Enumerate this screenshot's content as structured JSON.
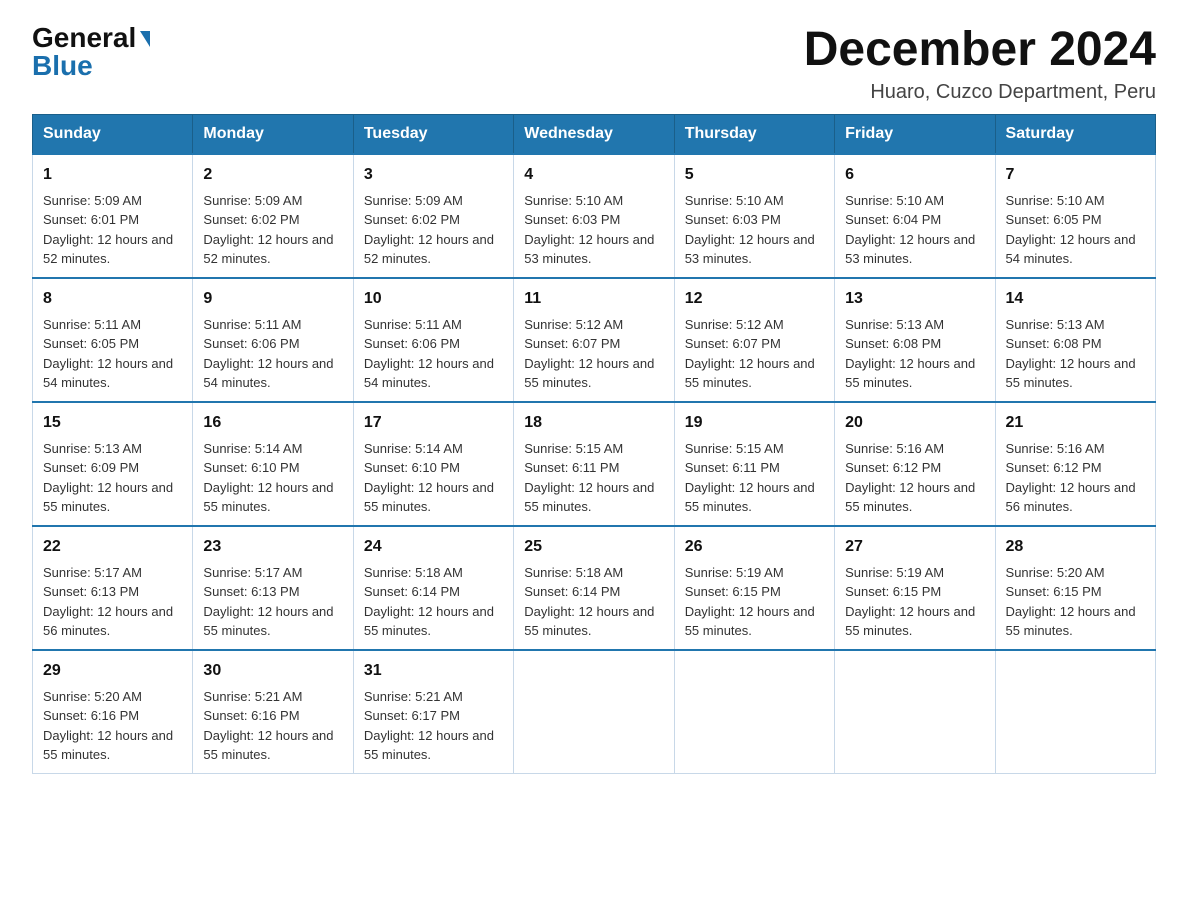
{
  "header": {
    "logo_general": "General",
    "logo_blue": "Blue",
    "title": "December 2024",
    "subtitle": "Huaro, Cuzco Department, Peru"
  },
  "days_of_week": [
    "Sunday",
    "Monday",
    "Tuesday",
    "Wednesday",
    "Thursday",
    "Friday",
    "Saturday"
  ],
  "weeks": [
    [
      {
        "num": "1",
        "sunrise": "5:09 AM",
        "sunset": "6:01 PM",
        "daylight": "12 hours and 52 minutes."
      },
      {
        "num": "2",
        "sunrise": "5:09 AM",
        "sunset": "6:02 PM",
        "daylight": "12 hours and 52 minutes."
      },
      {
        "num": "3",
        "sunrise": "5:09 AM",
        "sunset": "6:02 PM",
        "daylight": "12 hours and 52 minutes."
      },
      {
        "num": "4",
        "sunrise": "5:10 AM",
        "sunset": "6:03 PM",
        "daylight": "12 hours and 53 minutes."
      },
      {
        "num": "5",
        "sunrise": "5:10 AM",
        "sunset": "6:03 PM",
        "daylight": "12 hours and 53 minutes."
      },
      {
        "num": "6",
        "sunrise": "5:10 AM",
        "sunset": "6:04 PM",
        "daylight": "12 hours and 53 minutes."
      },
      {
        "num": "7",
        "sunrise": "5:10 AM",
        "sunset": "6:05 PM",
        "daylight": "12 hours and 54 minutes."
      }
    ],
    [
      {
        "num": "8",
        "sunrise": "5:11 AM",
        "sunset": "6:05 PM",
        "daylight": "12 hours and 54 minutes."
      },
      {
        "num": "9",
        "sunrise": "5:11 AM",
        "sunset": "6:06 PM",
        "daylight": "12 hours and 54 minutes."
      },
      {
        "num": "10",
        "sunrise": "5:11 AM",
        "sunset": "6:06 PM",
        "daylight": "12 hours and 54 minutes."
      },
      {
        "num": "11",
        "sunrise": "5:12 AM",
        "sunset": "6:07 PM",
        "daylight": "12 hours and 55 minutes."
      },
      {
        "num": "12",
        "sunrise": "5:12 AM",
        "sunset": "6:07 PM",
        "daylight": "12 hours and 55 minutes."
      },
      {
        "num": "13",
        "sunrise": "5:13 AM",
        "sunset": "6:08 PM",
        "daylight": "12 hours and 55 minutes."
      },
      {
        "num": "14",
        "sunrise": "5:13 AM",
        "sunset": "6:08 PM",
        "daylight": "12 hours and 55 minutes."
      }
    ],
    [
      {
        "num": "15",
        "sunrise": "5:13 AM",
        "sunset": "6:09 PM",
        "daylight": "12 hours and 55 minutes."
      },
      {
        "num": "16",
        "sunrise": "5:14 AM",
        "sunset": "6:10 PM",
        "daylight": "12 hours and 55 minutes."
      },
      {
        "num": "17",
        "sunrise": "5:14 AM",
        "sunset": "6:10 PM",
        "daylight": "12 hours and 55 minutes."
      },
      {
        "num": "18",
        "sunrise": "5:15 AM",
        "sunset": "6:11 PM",
        "daylight": "12 hours and 55 minutes."
      },
      {
        "num": "19",
        "sunrise": "5:15 AM",
        "sunset": "6:11 PM",
        "daylight": "12 hours and 55 minutes."
      },
      {
        "num": "20",
        "sunrise": "5:16 AM",
        "sunset": "6:12 PM",
        "daylight": "12 hours and 55 minutes."
      },
      {
        "num": "21",
        "sunrise": "5:16 AM",
        "sunset": "6:12 PM",
        "daylight": "12 hours and 56 minutes."
      }
    ],
    [
      {
        "num": "22",
        "sunrise": "5:17 AM",
        "sunset": "6:13 PM",
        "daylight": "12 hours and 56 minutes."
      },
      {
        "num": "23",
        "sunrise": "5:17 AM",
        "sunset": "6:13 PM",
        "daylight": "12 hours and 55 minutes."
      },
      {
        "num": "24",
        "sunrise": "5:18 AM",
        "sunset": "6:14 PM",
        "daylight": "12 hours and 55 minutes."
      },
      {
        "num": "25",
        "sunrise": "5:18 AM",
        "sunset": "6:14 PM",
        "daylight": "12 hours and 55 minutes."
      },
      {
        "num": "26",
        "sunrise": "5:19 AM",
        "sunset": "6:15 PM",
        "daylight": "12 hours and 55 minutes."
      },
      {
        "num": "27",
        "sunrise": "5:19 AM",
        "sunset": "6:15 PM",
        "daylight": "12 hours and 55 minutes."
      },
      {
        "num": "28",
        "sunrise": "5:20 AM",
        "sunset": "6:15 PM",
        "daylight": "12 hours and 55 minutes."
      }
    ],
    [
      {
        "num": "29",
        "sunrise": "5:20 AM",
        "sunset": "6:16 PM",
        "daylight": "12 hours and 55 minutes."
      },
      {
        "num": "30",
        "sunrise": "5:21 AM",
        "sunset": "6:16 PM",
        "daylight": "12 hours and 55 minutes."
      },
      {
        "num": "31",
        "sunrise": "5:21 AM",
        "sunset": "6:17 PM",
        "daylight": "12 hours and 55 minutes."
      },
      null,
      null,
      null,
      null
    ]
  ],
  "accent_color": "#2176ae"
}
